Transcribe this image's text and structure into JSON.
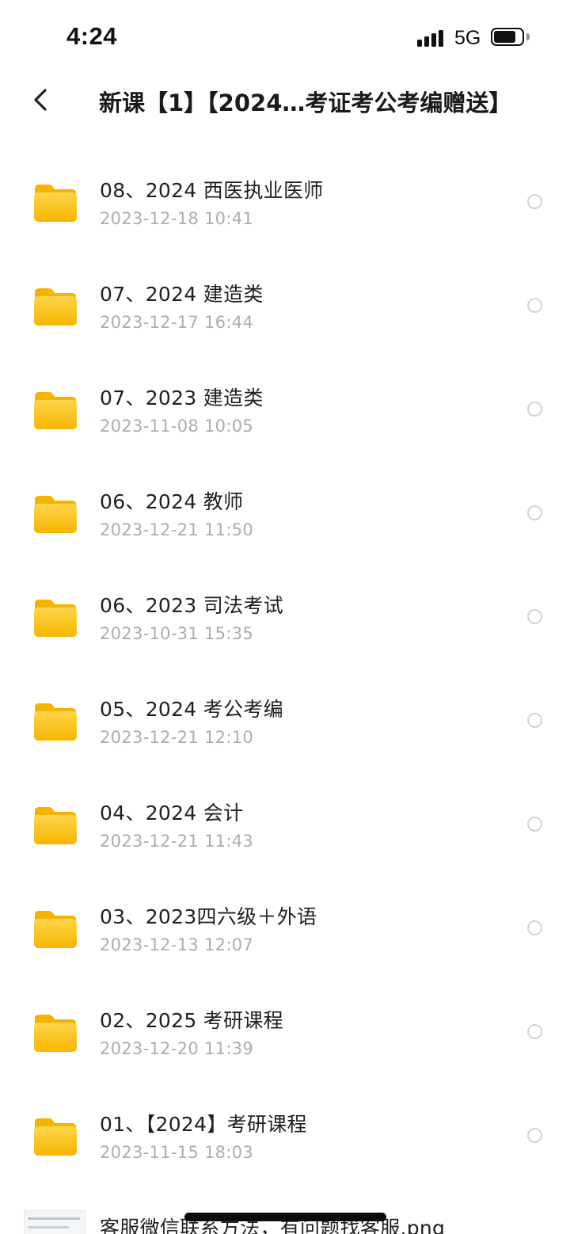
{
  "status_bar": {
    "time": "4:24",
    "network": "5G",
    "battery_level": 0.78
  },
  "nav": {
    "back_icon": "chevron-left-icon",
    "title": "新课【1】【2024…考证考公考编赠送】"
  },
  "folder_icon": {
    "name": "folder-icon",
    "color_top": "#fdd54a",
    "color_bottom": "#f7b500"
  },
  "items": [
    {
      "title": "08、2024 西医执业医师",
      "date": "2023-12-18 10:41"
    },
    {
      "title": "07、2024 建造类",
      "date": "2023-12-17 16:44"
    },
    {
      "title": "07、2023 建造类",
      "date": "2023-11-08 10:05"
    },
    {
      "title": "06、2024 教师",
      "date": "2023-12-21 11:50"
    },
    {
      "title": "06、2023 司法考试",
      "date": "2023-10-31 15:35"
    },
    {
      "title": "05、2024 考公考编",
      "date": "2023-12-21 12:10"
    },
    {
      "title": "04、2024 会计",
      "date": "2023-12-21 11:43"
    },
    {
      "title": "03、2023四六级＋外语",
      "date": "2023-12-13 12:07"
    },
    {
      "title": "02、2025 考研课程",
      "date": "2023-12-20 11:39"
    },
    {
      "title": "01、【2024】考研课程",
      "date": "2023-11-15 18:03"
    }
  ],
  "file_item": {
    "title": "客服微信联系方法，有问题找客服.png"
  }
}
